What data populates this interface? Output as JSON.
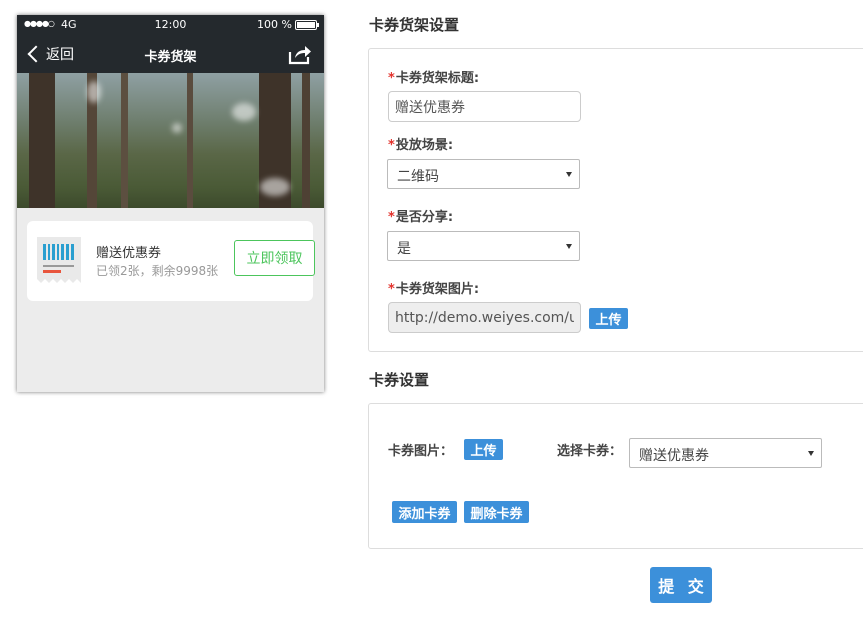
{
  "phone": {
    "status": {
      "signal": "●●●●○",
      "network": "4G",
      "time": "12:00",
      "battery": "100 %"
    },
    "nav": {
      "back_label": "返回",
      "title": "卡券货架"
    },
    "coupon": {
      "name": "赠送优惠券",
      "stats": "已领2张，剩余9998张",
      "button": "立即领取"
    }
  },
  "shelf_settings": {
    "title": "卡券货架设置",
    "required_mark": "*",
    "title_label": "卡券货架标题:",
    "title_value": "赠送优惠券",
    "scene_label": "投放场景:",
    "scene_value": "二维码",
    "share_label": "是否分享:",
    "share_value": "是",
    "image_label": "卡券货架图片:",
    "image_url": "http://demo.weiyes.com/up",
    "upload_button": "上传"
  },
  "coupon_settings": {
    "title": "卡券设置",
    "image_label": "卡券图片：",
    "upload_button": "上传",
    "select_label": "选择卡券：",
    "select_value": "赠送优惠券",
    "add_button": "添加卡券",
    "delete_button": "删除卡券"
  },
  "submit_label": "提 交",
  "colors": {
    "accent": "#3c90da",
    "green": "#4cc55c",
    "required": "#e2322c",
    "nav_bg": "#24292d"
  }
}
